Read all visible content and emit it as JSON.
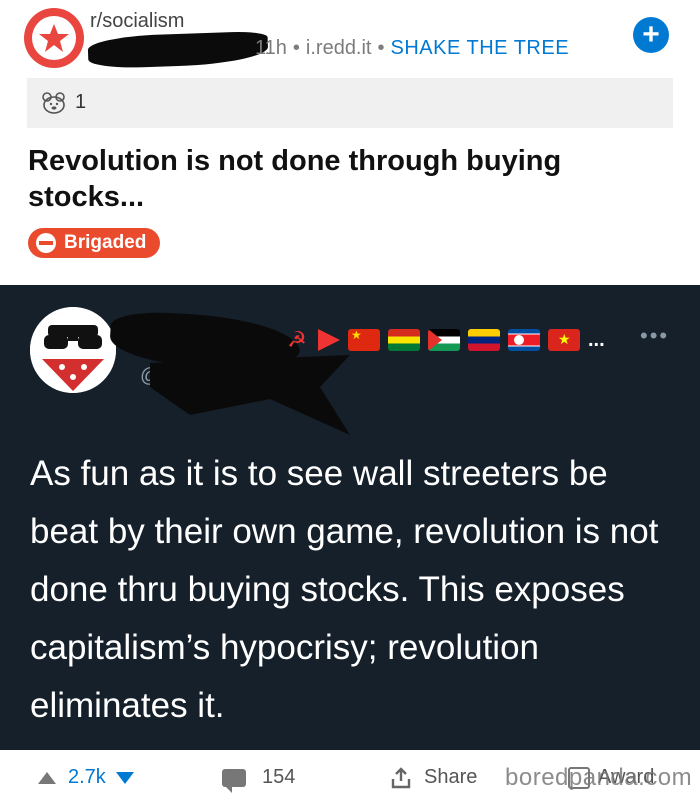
{
  "post": {
    "subreddit": "r/socialism",
    "age": "11h",
    "domain": "i.redd.it",
    "flair": "SHAKE THE TREE",
    "join_symbol": "+",
    "award_count": "1",
    "title": "Revolution is not done through buying stocks...",
    "tag": "Brigaded"
  },
  "tweet": {
    "handle": "@",
    "more": "•••",
    "flags_more": "...",
    "body": "As fun as it is to see wall streeters be beat by their own game, revolution is not done thru buying stocks. This exposes capitalism’s hypocrisy; revolution eliminates it."
  },
  "actions": {
    "votes": "2.7k",
    "comments": "154",
    "share": "Share",
    "award": "Award"
  },
  "watermark": "boredpanda.com",
  "colors": {
    "accent_blue": "#0079d3",
    "brigaded_red": "#ea4b2c",
    "tweet_bg": "#15202b"
  },
  "icons": [
    "subreddit-star-icon",
    "bear-award-icon",
    "join-plus-icon",
    "upvote-icon",
    "downvote-icon",
    "comment-icon",
    "share-icon",
    "award-gift-icon"
  ]
}
